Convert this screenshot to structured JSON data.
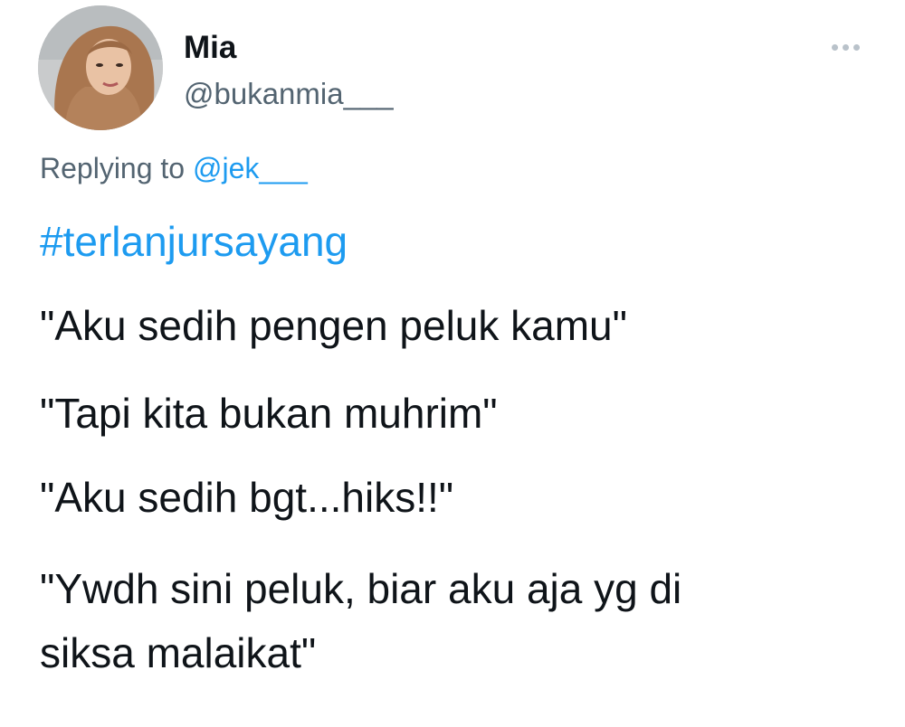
{
  "tweet": {
    "display_name": "Mia",
    "handle": "@bukanmia___",
    "more_icon": "more-horizontal-icon",
    "replying_prefix": "Replying to",
    "replying_to": "@jek___",
    "hashtag": "#terlanjursayang",
    "lines": [
      "\"Aku sedih pengen peluk kamu\"",
      "\"Tapi kita bukan muhrim\"",
      "\"Aku sedih bgt...hiks!!\"",
      "\"Ywdh sini peluk, biar aku aja yg di",
      "siksa malaikat\""
    ]
  },
  "colors": {
    "link": "#1d9bf0",
    "secondary_text": "#536471",
    "primary_text": "#0f1419",
    "more_dots": "#b9c2ca"
  }
}
